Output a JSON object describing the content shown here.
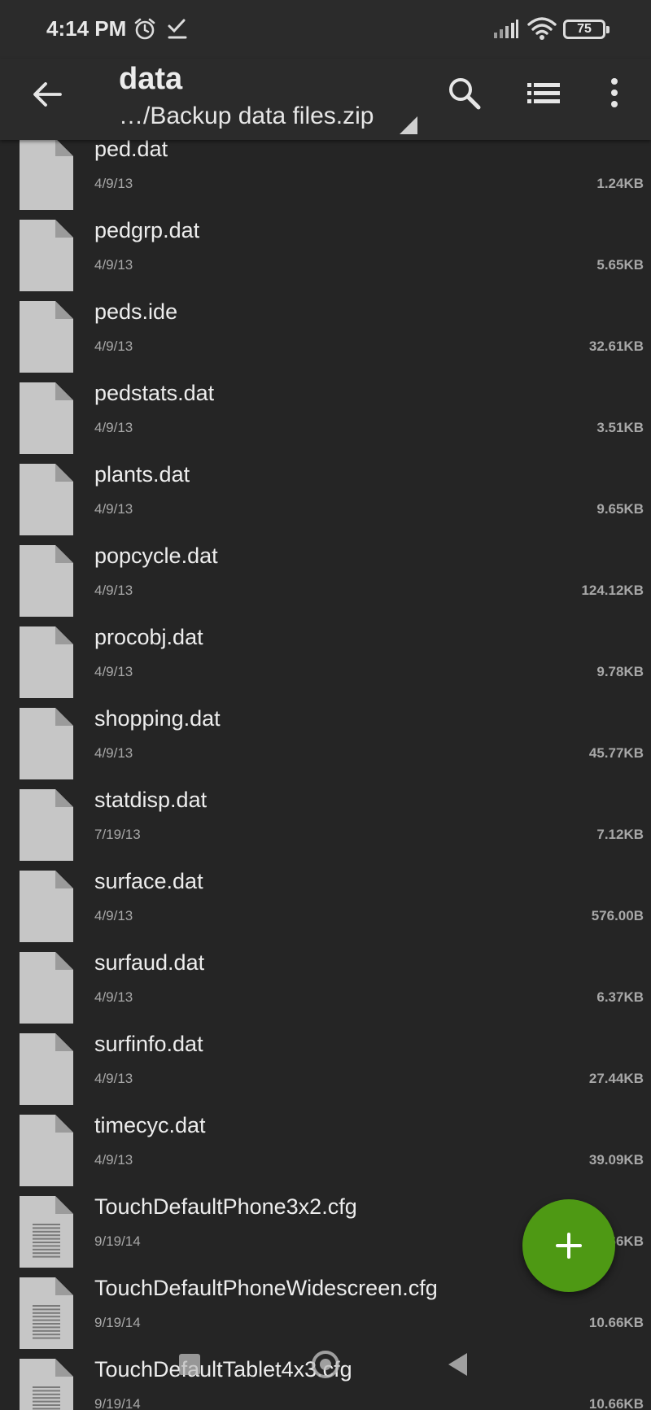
{
  "status_bar": {
    "time": "4:14 PM",
    "battery": "75",
    "icons": [
      "alarm-icon",
      "task-done-icon",
      "signal-icon",
      "wifi-icon",
      "battery-icon"
    ]
  },
  "toolbar": {
    "title": "data",
    "path": "…/Backup data files.zip",
    "icons": [
      "back-arrow-icon",
      "search-icon",
      "list-view-icon",
      "more-vert-icon"
    ]
  },
  "files": [
    {
      "name": "ped.dat",
      "date": "4/9/13",
      "size": "1.24KB",
      "icon": "file-icon"
    },
    {
      "name": "pedgrp.dat",
      "date": "4/9/13",
      "size": "5.65KB",
      "icon": "file-icon"
    },
    {
      "name": "peds.ide",
      "date": "4/9/13",
      "size": "32.61KB",
      "icon": "file-icon"
    },
    {
      "name": "pedstats.dat",
      "date": "4/9/13",
      "size": "3.51KB",
      "icon": "file-icon"
    },
    {
      "name": "plants.dat",
      "date": "4/9/13",
      "size": "9.65KB",
      "icon": "file-icon"
    },
    {
      "name": "popcycle.dat",
      "date": "4/9/13",
      "size": "124.12KB",
      "icon": "file-icon"
    },
    {
      "name": "procobj.dat",
      "date": "4/9/13",
      "size": "9.78KB",
      "icon": "file-icon"
    },
    {
      "name": "shopping.dat",
      "date": "4/9/13",
      "size": "45.77KB",
      "icon": "file-icon"
    },
    {
      "name": "statdisp.dat",
      "date": "7/19/13",
      "size": "7.12KB",
      "icon": "file-icon"
    },
    {
      "name": "surface.dat",
      "date": "4/9/13",
      "size": "576.00B",
      "icon": "file-icon"
    },
    {
      "name": "surfaud.dat",
      "date": "4/9/13",
      "size": "6.37KB",
      "icon": "file-icon"
    },
    {
      "name": "surfinfo.dat",
      "date": "4/9/13",
      "size": "27.44KB",
      "icon": "file-icon"
    },
    {
      "name": "timecyc.dat",
      "date": "4/9/13",
      "size": "39.09KB",
      "icon": "file-icon"
    },
    {
      "name": "TouchDefaultPhone3x2.cfg",
      "date": "9/19/14",
      "size": "10.66KB",
      "icon": "text-file-icon"
    },
    {
      "name": "TouchDefaultPhoneWidescreen.cfg",
      "date": "9/19/14",
      "size": "10.66KB",
      "icon": "text-file-icon"
    },
    {
      "name": "TouchDefaultTablet4x3.cfg",
      "date": "9/19/14",
      "size": "10.66KB",
      "icon": "text-file-icon"
    }
  ],
  "fab": {
    "icon": "plus-icon"
  },
  "nav_bar": {
    "icons": [
      "recents-icon",
      "home-icon",
      "back-triangle-icon"
    ]
  }
}
